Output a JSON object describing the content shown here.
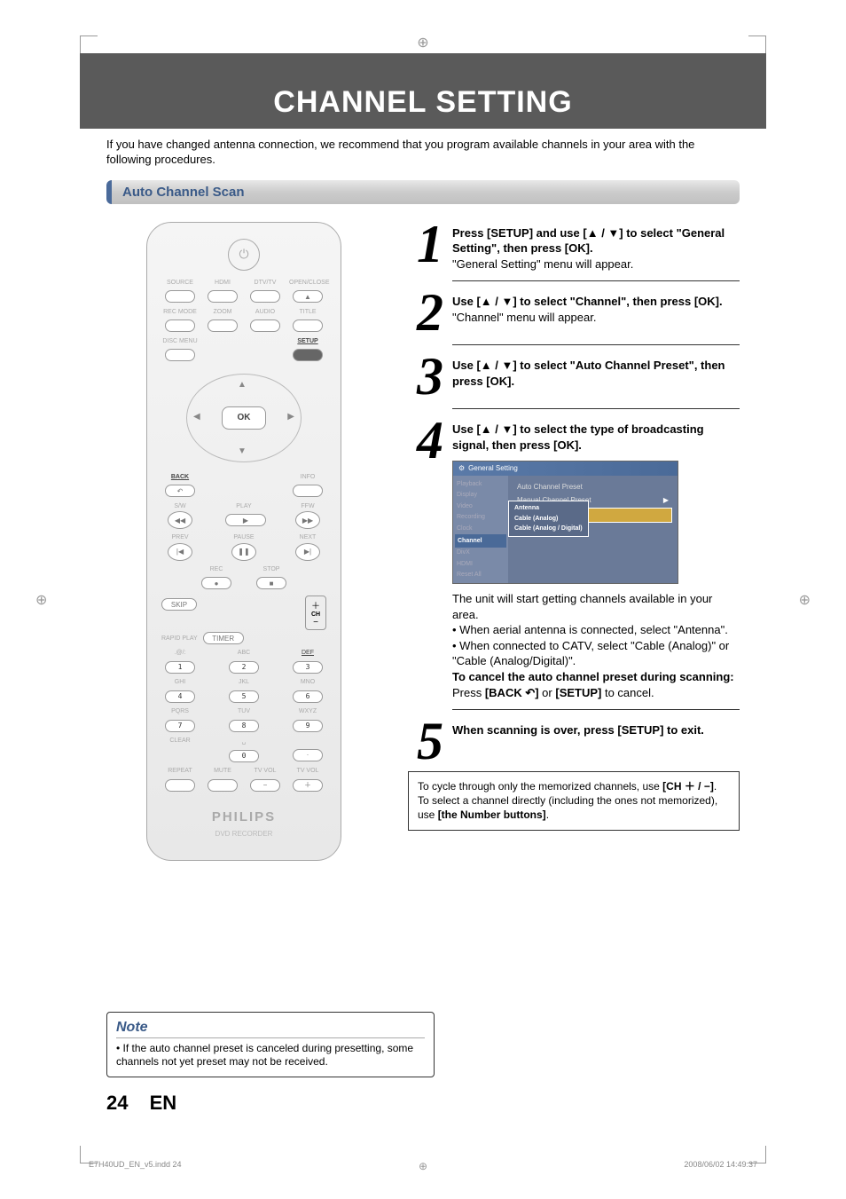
{
  "title": "CHANNEL SETTING",
  "intro": "If you have changed antenna connection, we recommend that you program available channels in your area with the following procedures.",
  "section": "Auto Channel Scan",
  "remote": {
    "row1": [
      "SOURCE",
      "HDMI",
      "DTV/TV",
      "OPEN/CLOSE"
    ],
    "row2": [
      "REC MODE",
      "ZOOM",
      "AUDIO",
      "TITLE"
    ],
    "row3a": "DISC MENU",
    "row3b": "SETUP",
    "ok": "OK",
    "back": "BACK",
    "info": "INFO",
    "backicon": "↶",
    "play": "PLAY",
    "rw": "◀◀",
    "ff": "▶▶",
    "slow": "S/W",
    "fwd": "FFW",
    "prev": "PREV",
    "pause": "PAUSE",
    "next": "NEXT",
    "rec": "REC",
    "stop": "STOP",
    "skip": "SKIP",
    "timer": "TIMER",
    "ch": "CH",
    "rapid": "RAPID PLAY",
    "numhints": [
      ".@/:",
      "ABC",
      "DEF",
      "GHI",
      "JKL",
      "MNO",
      "PQRS",
      "TUV",
      "WXYZ"
    ],
    "nums": [
      "1",
      "2",
      "3",
      "4",
      "5",
      "6",
      "7",
      "8",
      "9",
      "0"
    ],
    "sp": "␣",
    "clear": "CLEAR",
    "repeat": "REPEAT",
    "mute": "MUTE",
    "tvvol": "TV VOL",
    "tvvol2": "TV VOL",
    "brand": "PHILIPS",
    "brandsub": "DVD RECORDER"
  },
  "steps": {
    "s1a": "Press [SETUP] and use [▲ / ▼] to select \"General Setting\", then press [OK].",
    "s1b": "\"General Setting\" menu will appear.",
    "s2a": "Use [▲ / ▼] to select \"Channel\", then press [OK].",
    "s2b": "\"Channel\" menu will appear.",
    "s3a": "Use [▲ / ▼] to select \"Auto Channel Preset\", then press [OK].",
    "s4a": "Use [▲ / ▼] to select the type of broadcasting signal, then press [OK].",
    "s4b": "The unit will start getting channels available in your area.",
    "s4c": "When aerial antenna is connected, select \"Antenna\".",
    "s4d": "When connected to CATV, select \"Cable (Analog)\" or \"Cable (Analog/Digital)\".",
    "s4e": "To cancel the auto channel preset during scanning:",
    "s4f1": "Press ",
    "s4f2": " or ",
    "s4f3": " to cancel.",
    "s4back": "[BACK ↶]",
    "s4setup": "[SETUP]",
    "s5a": "When scanning is over, press [SETUP] to exit."
  },
  "menu": {
    "header": "General Setting",
    "side": [
      "Playback",
      "Display",
      "Video",
      "Recording",
      "Clock",
      "Channel",
      "DivX",
      "HDMI",
      "Reset All"
    ],
    "lines": [
      "Auto Channel Preset",
      "Manual Channel Preset"
    ],
    "hi": "Auto Channel Preset",
    "popup": [
      "Antenna",
      "Cable (Analog)",
      "Cable (Analog / Digital)"
    ],
    "arrow": "▶"
  },
  "infobox": {
    "l1a": "To cycle through only the memorized channels, use ",
    "l1b": "[CH ＋ / −]",
    "l1c": ".",
    "l2a": "To select a channel directly (including the ones not memorized), use ",
    "l2b": "[the Number buttons]",
    "l2c": "."
  },
  "note": {
    "title": "Note",
    "body": "If the auto channel preset is canceled during presetting, some channels not yet preset may not be received."
  },
  "pagenum": "24",
  "pagelang": "EN",
  "footer": {
    "file": "E7H40UD_EN_v5.indd   24",
    "date": "2008/06/02   14:49:37"
  }
}
